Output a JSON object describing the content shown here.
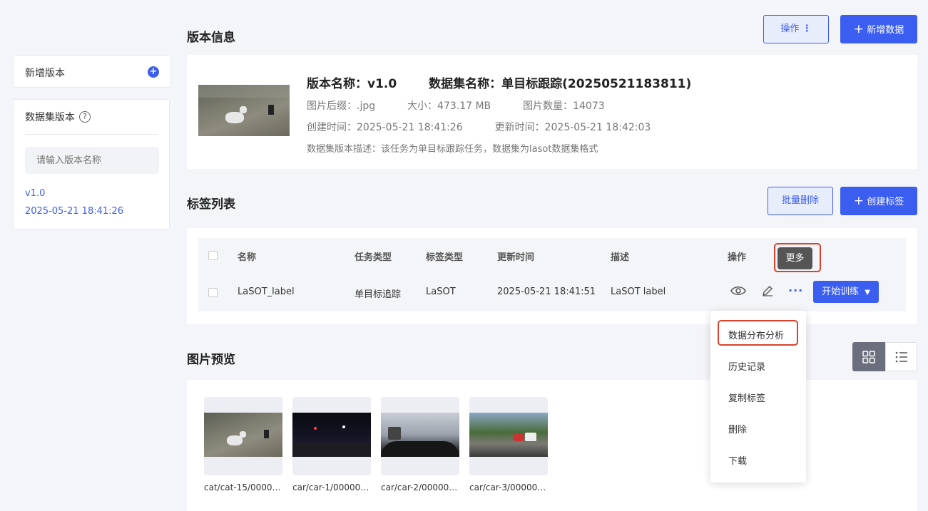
{
  "sidebar": {
    "new_version_label": "新增版本",
    "dataset_version_label": "数据集版本",
    "search_placeholder": "请输入版本名称",
    "versions": [
      {
        "name": "v1.0",
        "date": "2025-05-21 18:41:26"
      }
    ]
  },
  "version_info": {
    "section_title": "版本信息",
    "ops_button": "操作",
    "add_data_button": "新增数据",
    "version_name_label": "版本名称：",
    "version_name": "v1.0",
    "dataset_name_label": "数据集名称：",
    "dataset_name": "单目标跟踪(20250521183811)",
    "suffix_label": "图片后缀：",
    "suffix": ".jpg",
    "size_label": "大小：",
    "size": "473.17 MB",
    "count_label": "图片数量：",
    "count": "14073",
    "created_label": "创建时间：",
    "created": "2025-05-21 18:41:26",
    "updated_label": "更新时间：",
    "updated": "2025-05-21 18:42:03",
    "description_label": "数据集版本描述：",
    "description": "该任务为单目标跟踪任务，数据集为lasot数据集格式"
  },
  "label_list": {
    "section_title": "标签列表",
    "batch_delete_button": "批量删除",
    "create_label_button": "创建标签",
    "columns": [
      "名称",
      "任务类型",
      "标签类型",
      "更新时间",
      "描述",
      "操作"
    ],
    "rows": [
      {
        "name": "LaSOT_label",
        "task_type": "单目标追踪",
        "label_type": "LaSOT",
        "updated": "2025-05-21 18:41:51",
        "description": "LaSOT label"
      }
    ],
    "train_button": "开始训练",
    "more_tooltip": "更多"
  },
  "more_menu": {
    "items": [
      "数据分布分析",
      "历史记录",
      "复制标签",
      "删除",
      "下载"
    ],
    "highlight_color": "#d9412c"
  },
  "preview": {
    "section_title": "图片预览",
    "images": [
      {
        "caption": "cat/cat-15/000000…"
      },
      {
        "caption": "car/car-1/000000…"
      },
      {
        "caption": "car/car-2/000000…"
      },
      {
        "caption": "car/car-3/000000…"
      }
    ]
  },
  "colors": {
    "accent": "#3b5ef0",
    "highlight": "#d9412c"
  }
}
